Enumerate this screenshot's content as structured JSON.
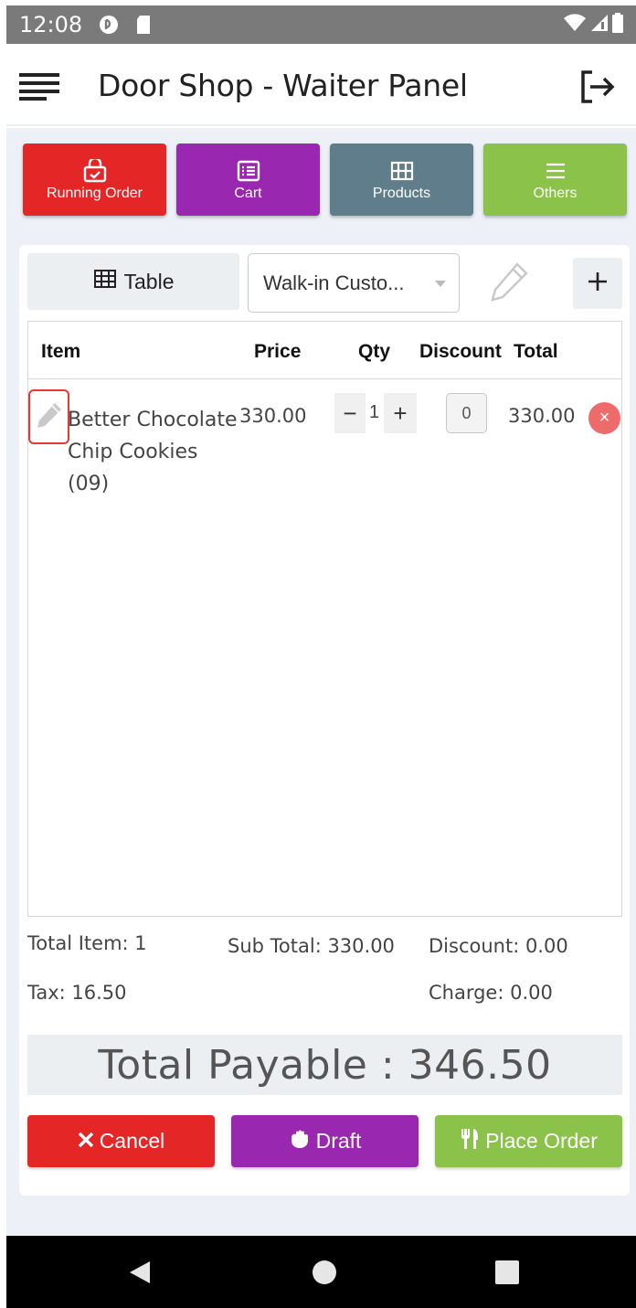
{
  "status_bar": {
    "time": "12:08",
    "icons": [
      "notification-icon",
      "sd-card-icon",
      "wifi-icon",
      "signal-icon",
      "battery-icon"
    ]
  },
  "app_bar": {
    "title": "Door Shop - Waiter Panel",
    "menu_icon": "hamburger-icon",
    "logout_icon": "logout-icon"
  },
  "nav_buttons": [
    {
      "label": "Running Order",
      "icon": "running-order-icon",
      "color": "#e42626"
    },
    {
      "label": "Cart",
      "icon": "list-icon",
      "color": "#9a27b0"
    },
    {
      "label": "Products",
      "icon": "grid-icon",
      "color": "#607d8b"
    },
    {
      "label": "Others",
      "icon": "menu-lines-icon",
      "color": "#8bc34a"
    }
  ],
  "order_controls": {
    "table_label": "Table",
    "customer_value": "Walk-in Custo...",
    "edit_icon": "pencil-icon",
    "add_icon": "plus-icon"
  },
  "cart_table": {
    "headers": {
      "item": "Item",
      "price": "Price",
      "qty": "Qty",
      "discount": "Discount",
      "total": "Total"
    },
    "rows": [
      {
        "item": "Better Chocolate Chip Cookies (09)",
        "price": "330.00",
        "qty_minus": "−",
        "qty": "1",
        "qty_plus": "+",
        "discount": "0",
        "total": "330.00",
        "remove": "×"
      }
    ]
  },
  "summary": {
    "total_item": "Total Item: 1",
    "sub_total": "Sub Total: 330.00",
    "discount": "Discount: 0.00",
    "tax": "Tax: 16.50",
    "charge": "Charge: 0.00",
    "total_payable": "Total Payable : 346.50"
  },
  "actions": {
    "cancel": "Cancel",
    "draft": "Draft",
    "place_order": "Place Order"
  },
  "colors": {
    "red": "#e42626",
    "purple": "#9a27b0",
    "slate": "#607d8b",
    "green": "#8bc34a"
  }
}
